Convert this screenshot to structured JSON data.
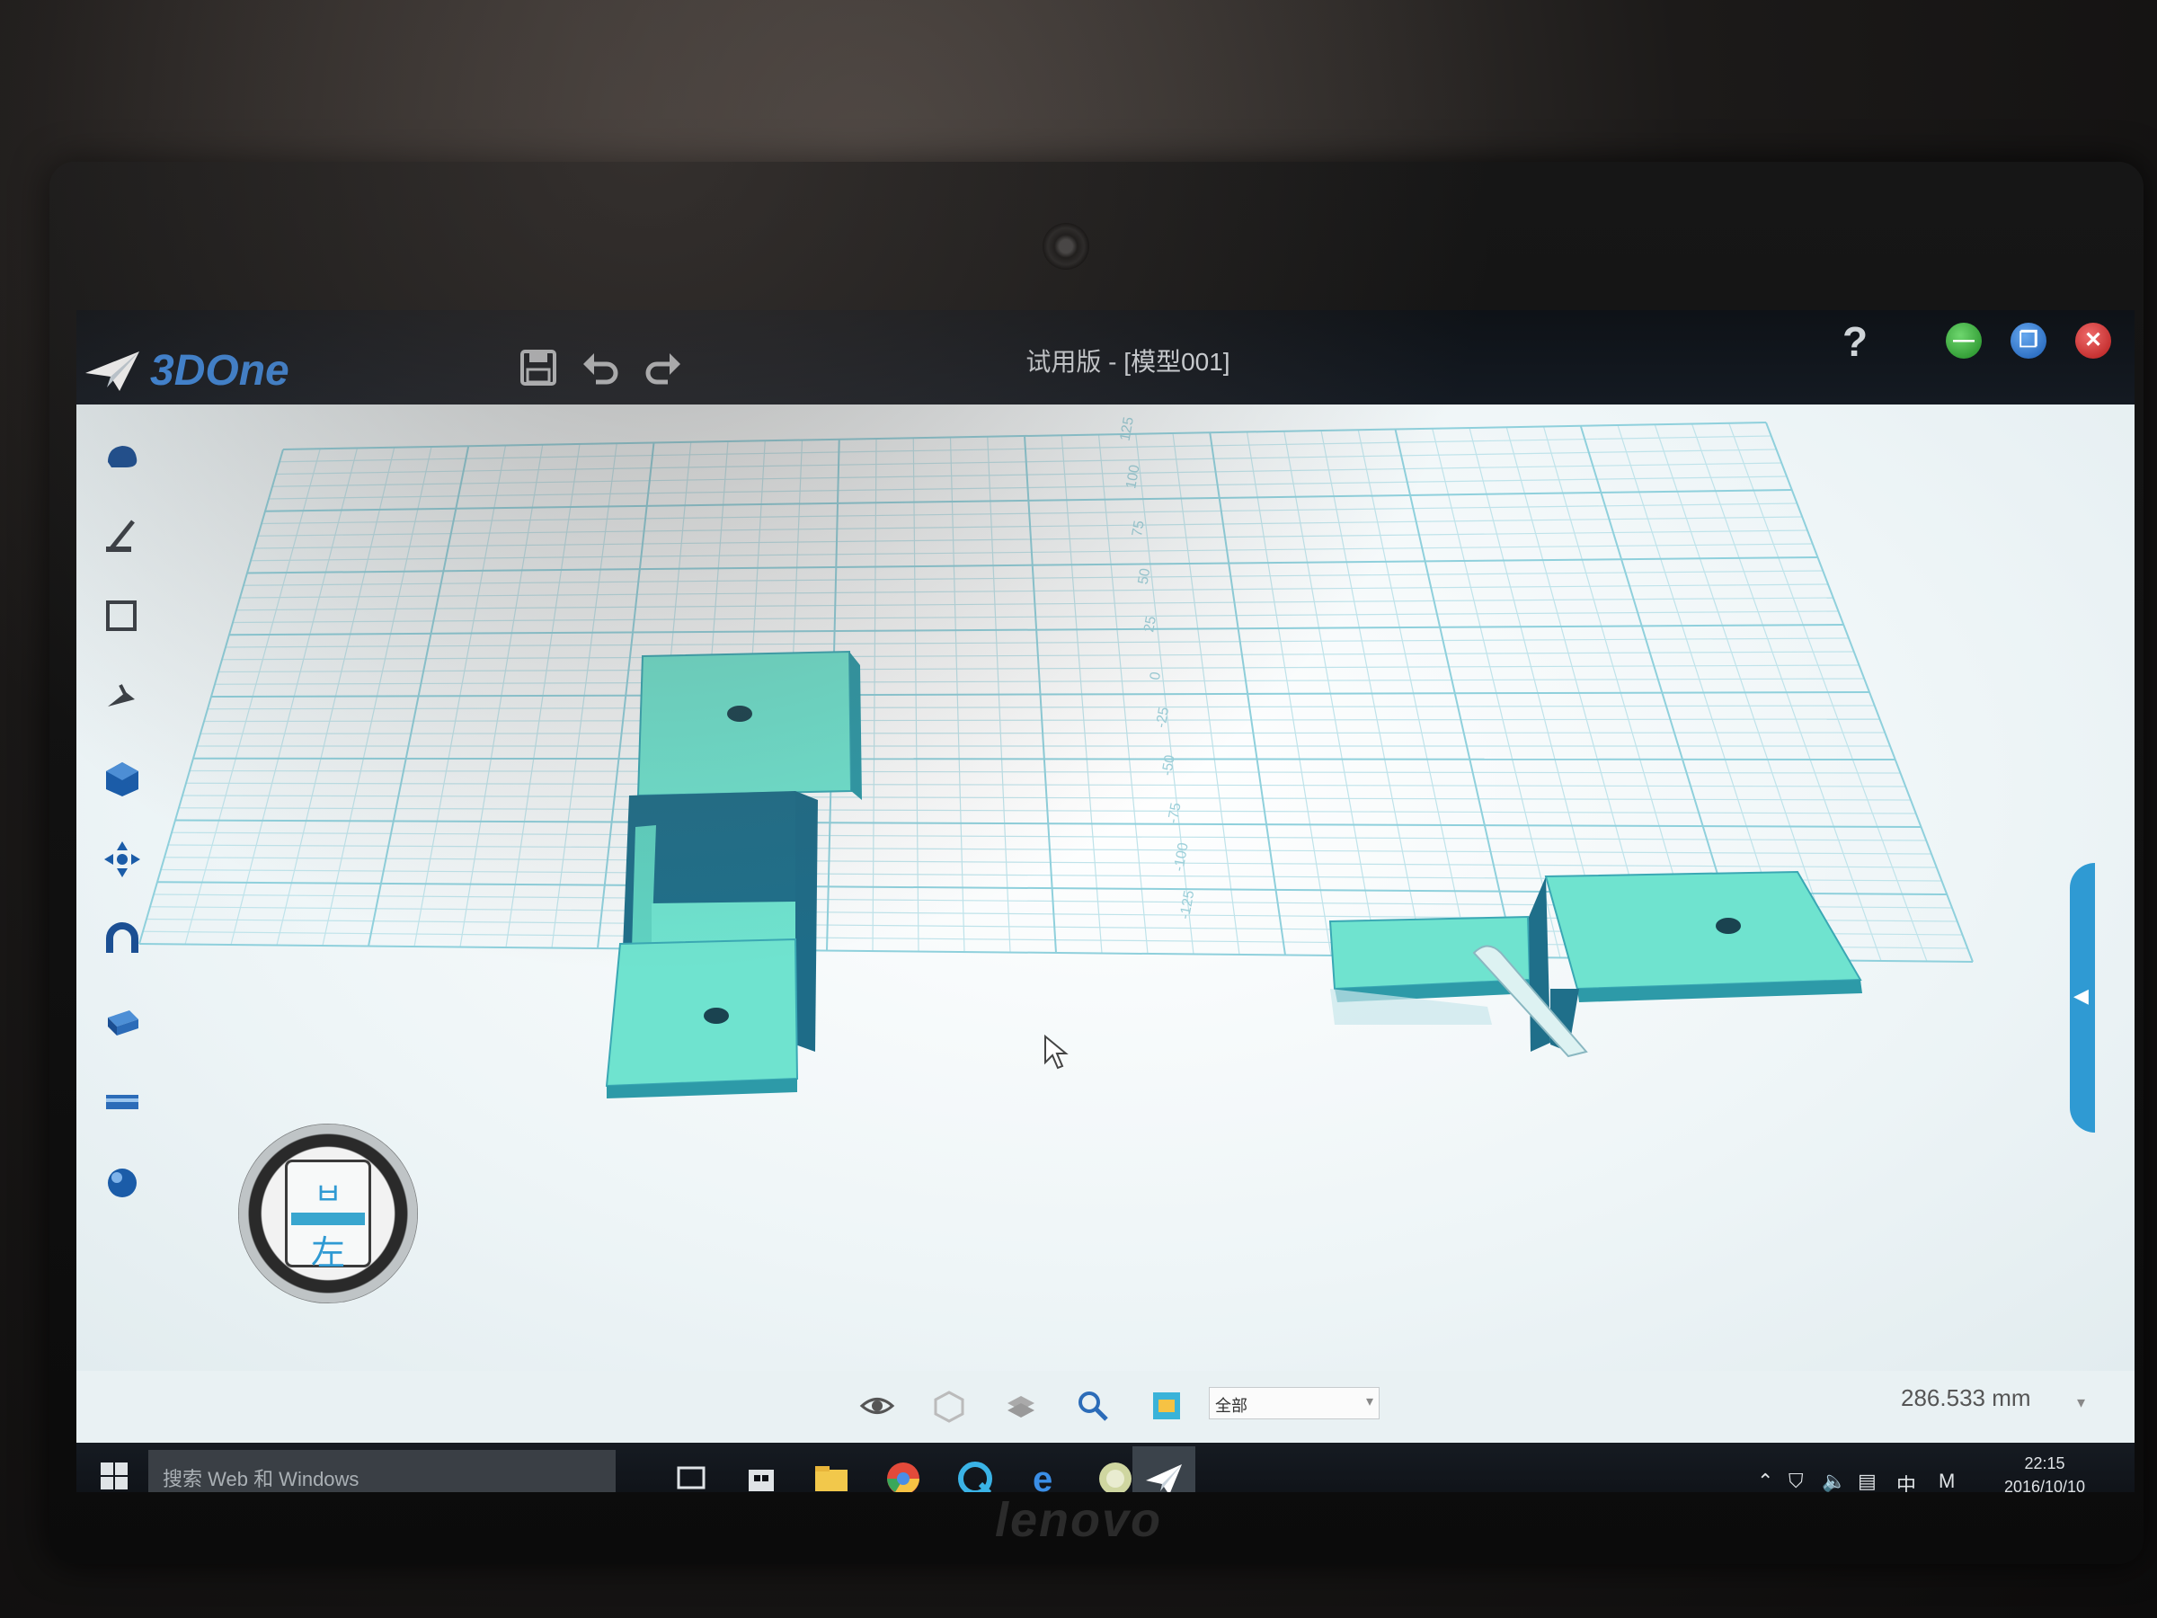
{
  "app": {
    "name": "3DOne",
    "title": "试用版 - [模型001]",
    "help_label": "?"
  },
  "window_controls": {
    "minimize": "—",
    "restore": "❐",
    "close": "✕"
  },
  "toolbar": {
    "save_icon": "save-icon",
    "undo_icon": "undo-icon",
    "redo_icon": "redo-icon"
  },
  "left_toolbar": {
    "items": [
      "basic-shape-icon",
      "sketch-icon",
      "sketch-edit-icon",
      "feature-modify-icon",
      "combine-icon",
      "move-icon",
      "magnet-icon",
      "assembly-icon",
      "text-bar-icon",
      "render-sphere-icon"
    ]
  },
  "viewcube": {
    "top_label": "ㅂ",
    "face_label": "左"
  },
  "grid_axis_labels": [
    "125",
    "100",
    "75",
    "50",
    "25",
    "0",
    "-25",
    "-50",
    "-75",
    "-100",
    "-125"
  ],
  "bottom_toolbar": {
    "icons": [
      "eye-icon",
      "hidden-icon",
      "layer-icon",
      "zoom-icon",
      "render-icon"
    ],
    "filter_value": "全部"
  },
  "measurement": "286.533 mm",
  "taskbar": {
    "search_placeholder": "搜索 Web 和 Windows",
    "tray": {
      "ime": "中",
      "mode": "M"
    },
    "time": "22:15",
    "date": "2016/10/10"
  },
  "colors": {
    "model": "#6fe3cf",
    "model_dark": "#1f6f8a",
    "grid": "#9fd6e0",
    "accent": "#2f9ad3"
  },
  "bezel_brand": "lenovo"
}
